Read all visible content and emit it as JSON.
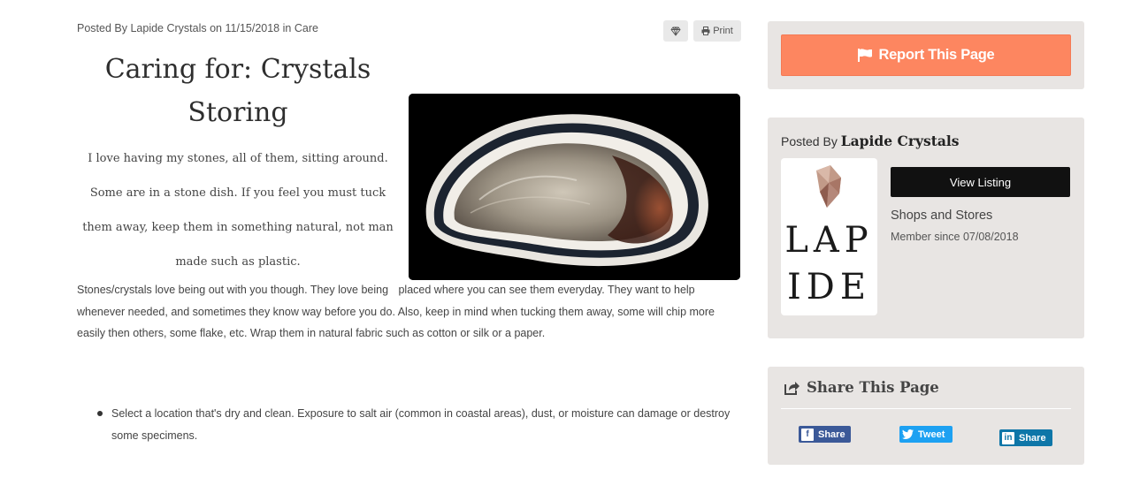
{
  "article": {
    "meta": {
      "prefix": "Posted By",
      "author": "Lapide Crystals",
      "on": "on",
      "date": "11/15/2018",
      "in": "in",
      "category": "Care"
    },
    "actions": {
      "gem_icon": "gem-icon",
      "print_label": "Print"
    },
    "title_line1": "Caring for: Crystals",
    "title_line2": "Storing",
    "intro": "I love having my stones, all of them, sitting around. Some are in a stone dish. If you feel you must tuck them away, keep them in something natural, not man made such as plastic.",
    "body_first": "Stones/crystals love being out with you though. They love being",
    "body_rest": "placed where you can see them everyday. They want to help whenever needed, and sometimes they know way before you do. Also, keep in mind when tucking them away, some will chip more easily then others, some flake, etc. Wrap them in natural fabric such as cotton or silk or a paper.",
    "bullets": [
      "Select a location that's dry and clean. Exposure to salt air (common in coastal areas), dust, or moisture can damage or destroy some specimens."
    ]
  },
  "sidebar": {
    "report": {
      "label": "Report This Page",
      "icon": "flag-icon",
      "color": "#fd8660"
    },
    "poster": {
      "prefix": "Posted By",
      "name": "Lapide Crystals",
      "logo_line1": "LAP",
      "logo_line2": "IDE",
      "view_label": "View Listing",
      "category": "Shops and Stores",
      "member_since": "Member since 07/08/2018"
    },
    "share": {
      "title": "Share This Page",
      "icon": "share-icon",
      "facebook_label": "Share",
      "twitter_label": "Tweet",
      "linkedin_label": "Share"
    }
  }
}
